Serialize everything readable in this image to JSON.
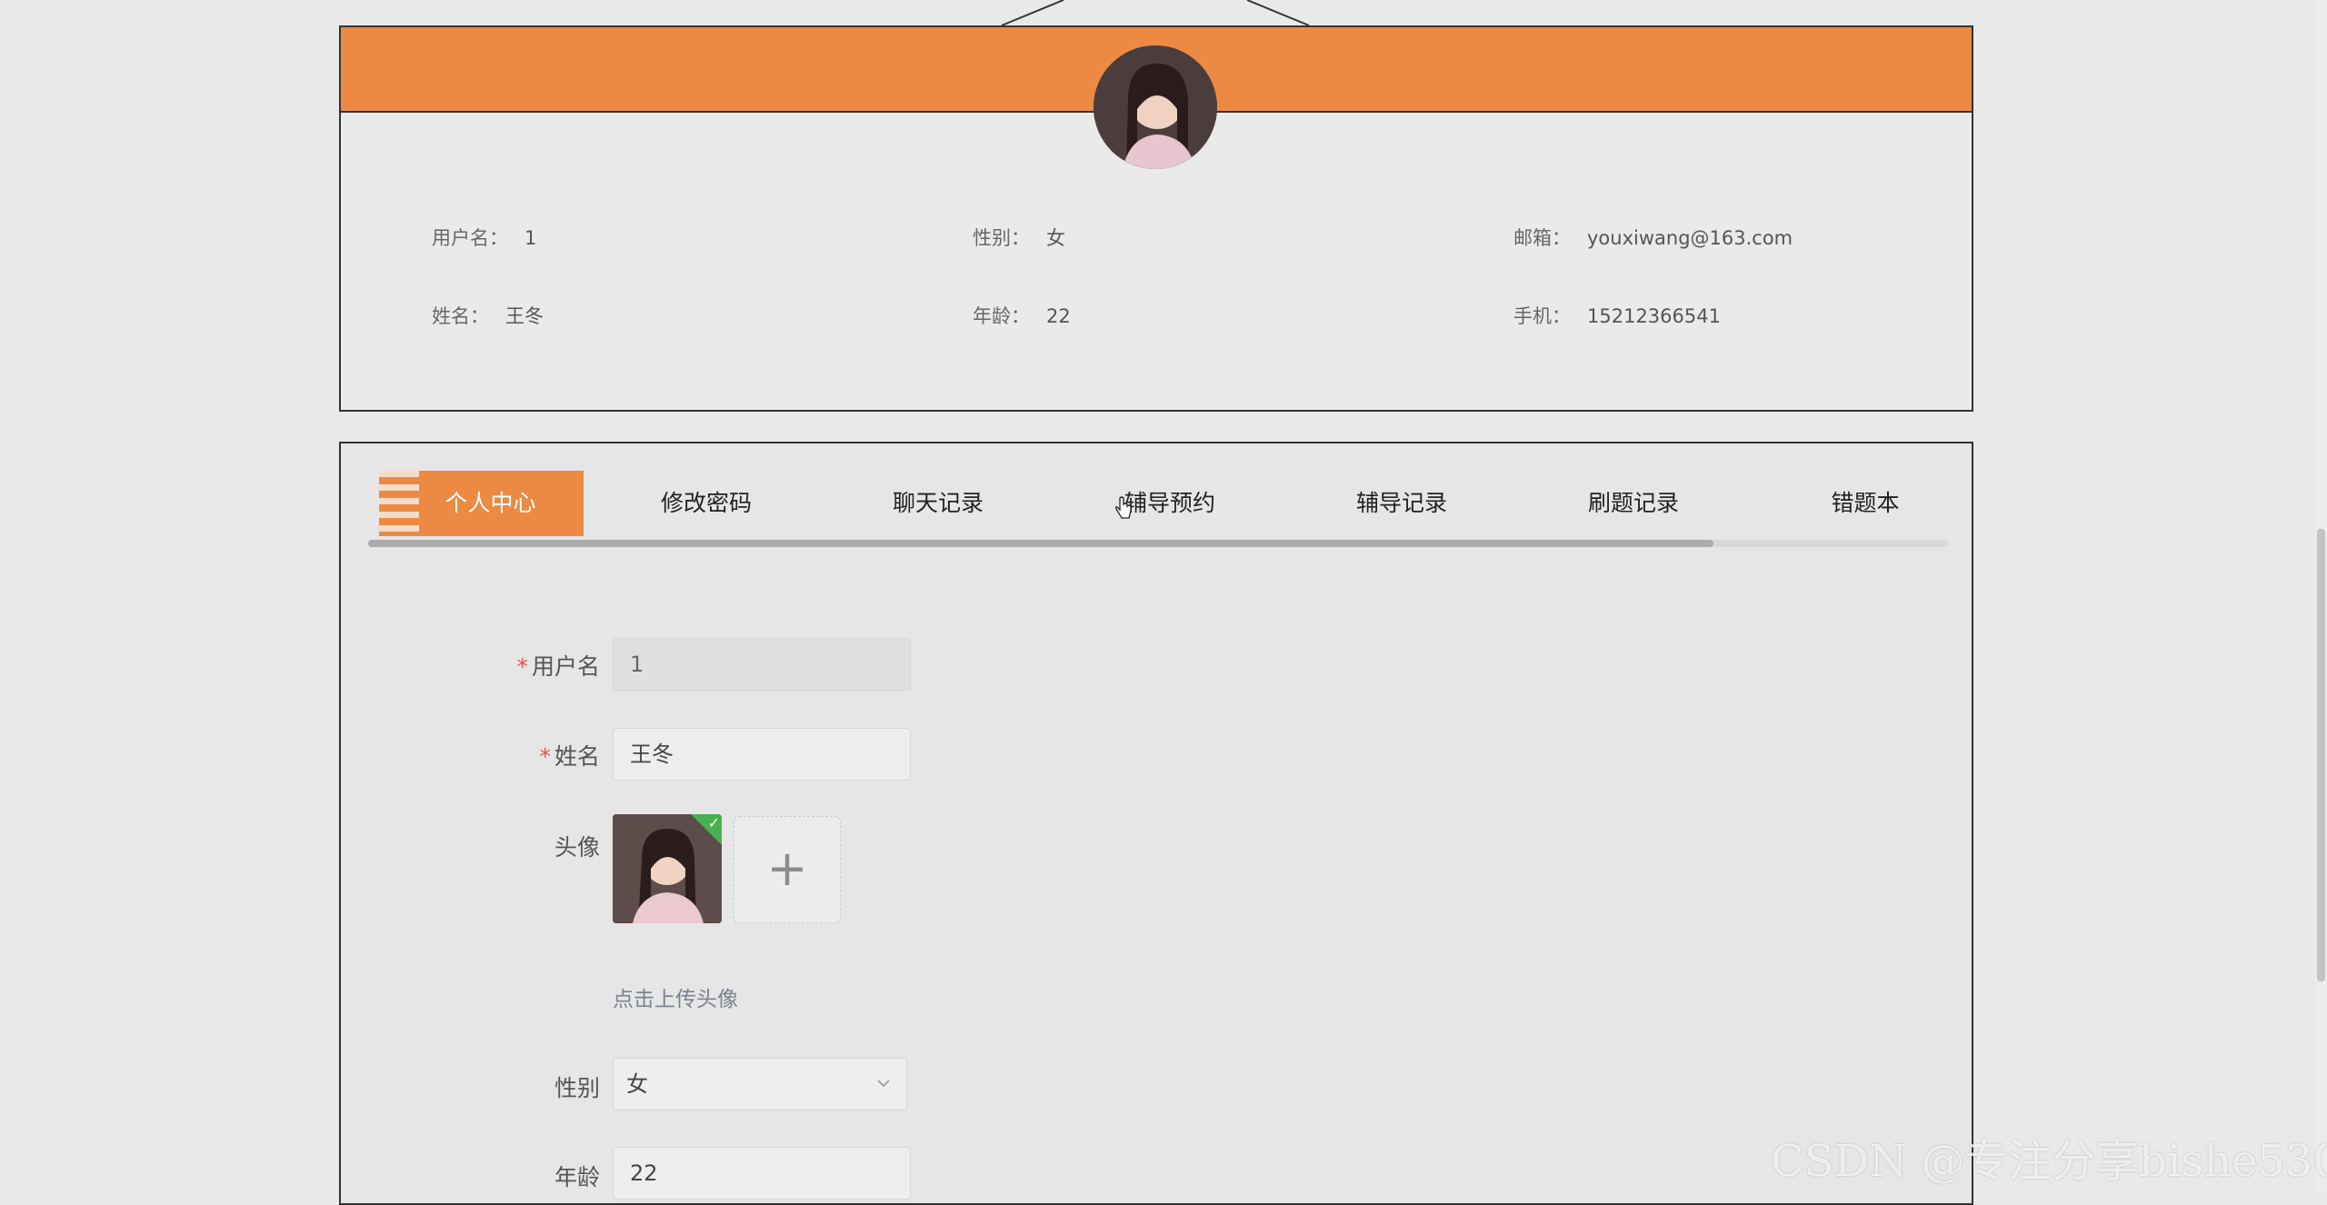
{
  "profile": {
    "fields": [
      {
        "label": "用户名：",
        "value": "1"
      },
      {
        "label": "性别：",
        "value": "女"
      },
      {
        "label": "邮箱：",
        "value": "youxiwang@163.com"
      },
      {
        "label": "姓名：",
        "value": "王冬"
      },
      {
        "label": "年龄：",
        "value": "22"
      },
      {
        "label": "手机：",
        "value": "15212366541"
      }
    ]
  },
  "tabs": [
    {
      "label": "个人中心",
      "active": true
    },
    {
      "label": "修改密码"
    },
    {
      "label": "聊天记录"
    },
    {
      "label": "辅导预约"
    },
    {
      "label": "辅导记录"
    },
    {
      "label": "刷题记录"
    },
    {
      "label": "错题本"
    }
  ],
  "form": {
    "username_label": "用户名",
    "username_value": "1",
    "name_label": "姓名",
    "name_value": "王冬",
    "avatar_label": "头像",
    "upload_link": "点击上传头像",
    "gender_label": "性别",
    "gender_value": "女",
    "age_label": "年龄",
    "age_value": "22"
  },
  "colors": {
    "accent": "#ec8a43",
    "required": "#e0544a",
    "success": "#49b04f"
  },
  "watermark": "CSDN @专注分享bishe530"
}
